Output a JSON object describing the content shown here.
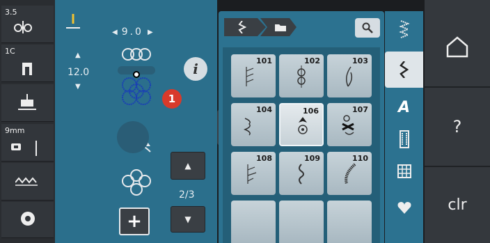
{
  "left_panel": {
    "tension_value": "3.5",
    "presser_foot": "1C",
    "needle_size": "9mm"
  },
  "stitch_settings": {
    "stitch_width": "9.0",
    "stitch_length": "12.0",
    "page_indicator": "2/3",
    "callout_number": "1",
    "info_label": "i",
    "add_label": "+"
  },
  "stitch_grid": {
    "tiles": [
      {
        "number": "101",
        "selected": false
      },
      {
        "number": "102",
        "selected": false
      },
      {
        "number": "103",
        "selected": false
      },
      {
        "number": "104",
        "selected": false
      },
      {
        "number": "106",
        "selected": true
      },
      {
        "number": "107",
        "selected": false
      },
      {
        "number": "108",
        "selected": false
      },
      {
        "number": "109",
        "selected": false
      },
      {
        "number": "110",
        "selected": false
      }
    ]
  },
  "categories": [
    "zigzag-stitch-icon",
    "decorative-stitch-icon",
    "alphabet-icon",
    "buttonhole-icon",
    "quilt-icon",
    "heart-icon"
  ],
  "category_alpha_label": "A",
  "right_menu": {
    "help_label": "?",
    "clear_label": "clr"
  },
  "colors": {
    "panel": "#2b6f8c",
    "accent": "#d83a2b"
  }
}
